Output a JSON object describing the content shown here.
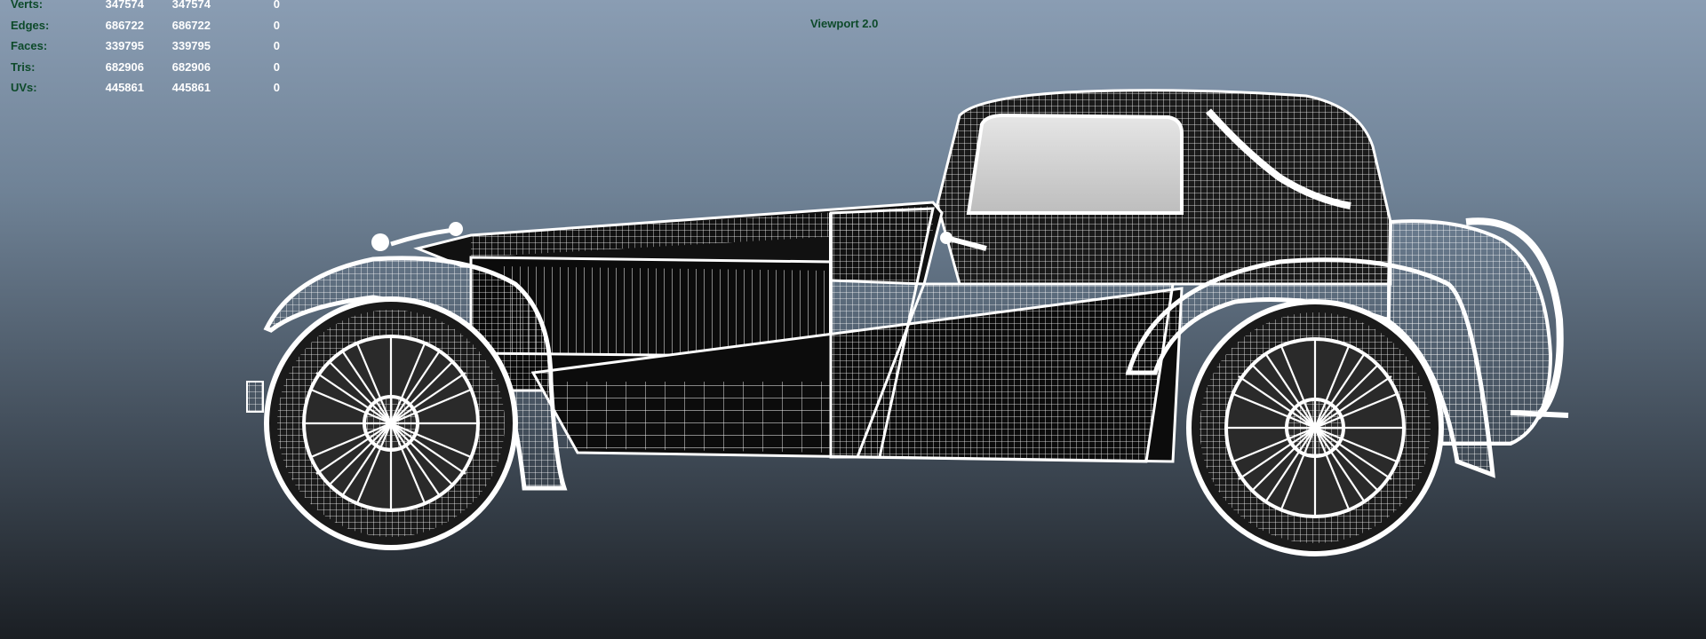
{
  "viewport": {
    "title": "Viewport 2.0"
  },
  "hud": {
    "rows": [
      {
        "label": "Verts:",
        "a": "347574",
        "b": "347574",
        "c": "0"
      },
      {
        "label": "Edges:",
        "a": "686722",
        "b": "686722",
        "c": "0"
      },
      {
        "label": "Faces:",
        "a": "339795",
        "b": "339795",
        "c": "0"
      },
      {
        "label": "Tris:",
        "a": "682906",
        "b": "682906",
        "c": "0"
      },
      {
        "label": "UVs:",
        "a": "445861",
        "b": "445861",
        "c": "0"
      }
    ]
  },
  "colors": {
    "hud_label": "#0d4a2a",
    "wireframe": "#ffffff",
    "bg_top": "#8a9db3",
    "bg_bottom": "#1b1f24"
  }
}
